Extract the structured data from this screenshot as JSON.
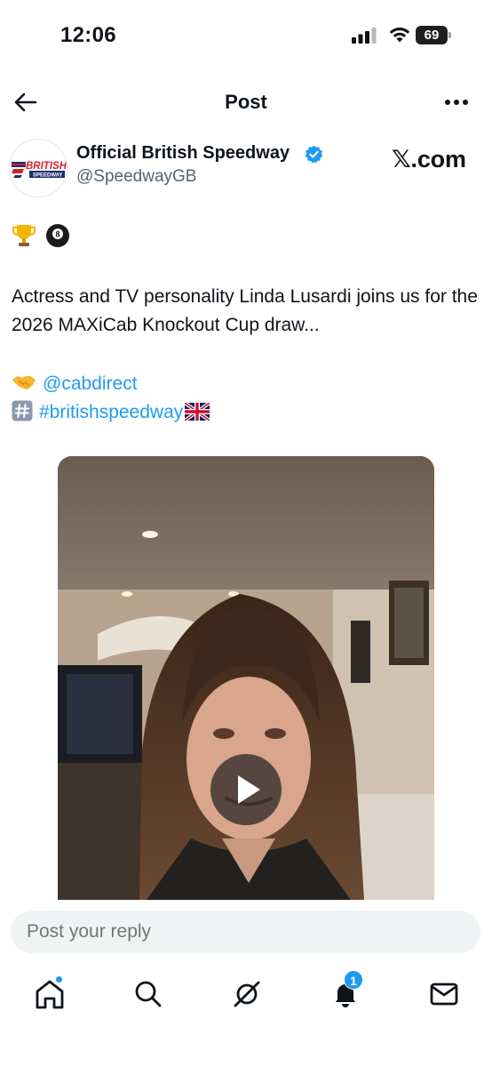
{
  "status_bar": {
    "time": "12:06",
    "battery": "69"
  },
  "header": {
    "title": "Post"
  },
  "author": {
    "name": "Official British Speedway",
    "handle": "@SpeedwayGB",
    "source": "𝕏.com",
    "avatar_logo_text": "BRITISH SPEEDWAY"
  },
  "post": {
    "emojis": [
      "trophy-icon",
      "eightball-icon"
    ],
    "text": "Actress and TV personality Linda Lusardi joins us for the 2026 MAXiCab Knockout Cup draw...",
    "mention_icon": "handshake-icon",
    "mention": "@cabdirect",
    "hashtag_icon": "hash-key-icon",
    "hashtag": "#britishspeedway",
    "hashtag_flag": "uk-flag-icon"
  },
  "media": {
    "type": "video",
    "play_icon": "play-icon"
  },
  "reply": {
    "placeholder": "Post your reply"
  },
  "tab_bar": {
    "items": [
      "home-icon",
      "search-icon",
      "grok-icon",
      "notifications-icon",
      "messages-icon"
    ],
    "notification_count": "1"
  },
  "colors": {
    "accent": "#1d9bf0",
    "text": "#0f1419",
    "muted": "#536471",
    "input_bg": "#eff3f4"
  }
}
